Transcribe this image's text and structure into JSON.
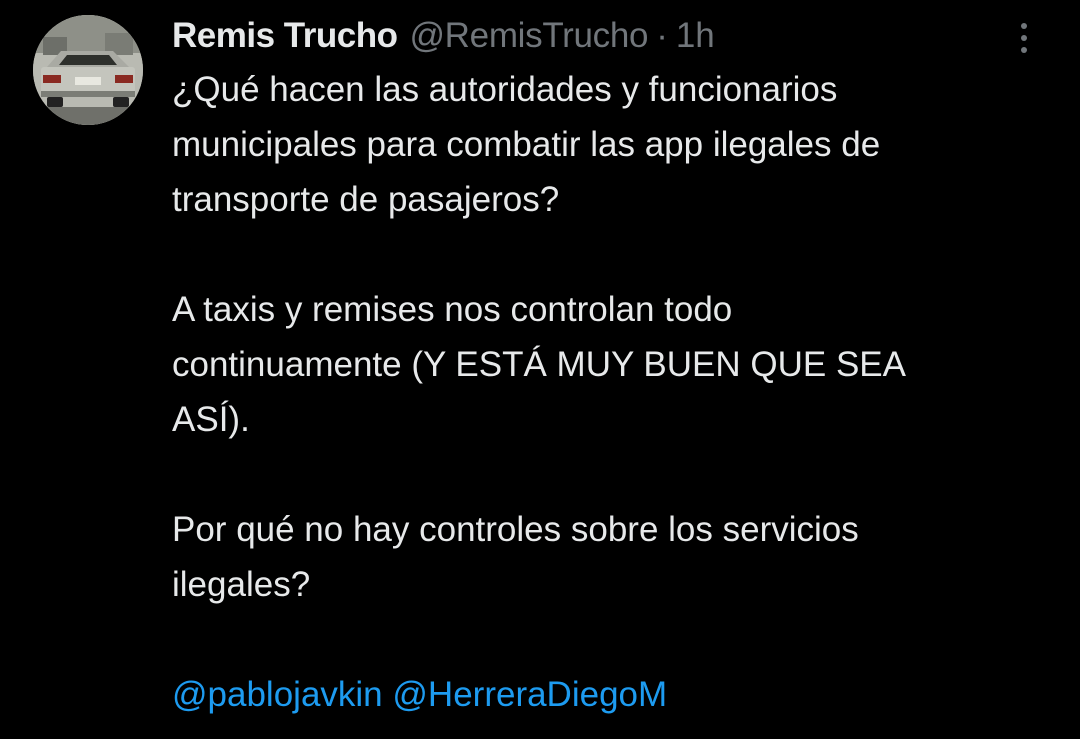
{
  "tweet": {
    "author": {
      "display_name": "Remis Trucho",
      "handle": "@RemisTrucho",
      "separator": "·",
      "time": "1h",
      "avatar_icon": "car-photo-avatar"
    },
    "more_icon": "more-vertical-icon",
    "paragraphs": [
      [
        "¿Qué hacen las autoridades y funcionarios",
        "municipales para combatir las app ilegales de",
        "transporte de pasajeros?"
      ],
      [
        "A taxis y remises nos controlan todo",
        "continuamente (Y ESTÁ MUY BUEN QUE SEA",
        "ASÍ)."
      ],
      [
        "Por qué no hay controles sobre los servicios",
        "ilegales?"
      ]
    ],
    "mentions": [
      "@pablojavkin",
      "@HerreraDiegoM"
    ]
  },
  "colors": {
    "background": "#000000",
    "text_primary": "#e7e9ea",
    "text_secondary": "#71767b",
    "link": "#1d9bf0"
  }
}
